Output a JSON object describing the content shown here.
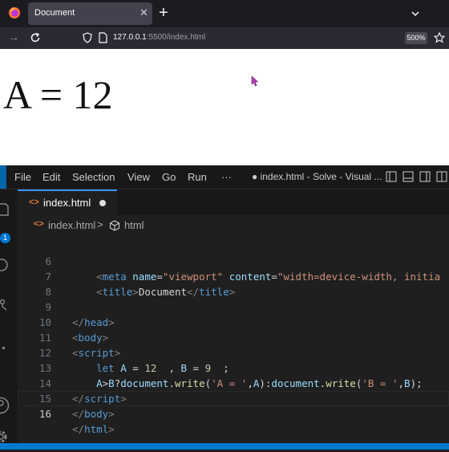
{
  "browser": {
    "tab_title": "Document",
    "tab_close_glyph": "✕",
    "new_tab_glyph": "+",
    "back_glyph": "→",
    "url_host": "127.0.0.1",
    "url_port_path": ":5500/index.html",
    "zoom": "500%"
  },
  "page": {
    "output": "A = 12"
  },
  "vscode": {
    "menu": [
      "File",
      "Edit",
      "Selection",
      "View",
      "Go",
      "Run",
      "···"
    ],
    "window_title": "● index.html - Solve - Visual ...",
    "activity_badge": "1",
    "editor_tab": {
      "icon": "<>",
      "label": "index.html"
    },
    "breadcrumb": {
      "icon": "<>",
      "file": "index.html",
      "separator": ">",
      "symbol": "html"
    },
    "active_line": 16,
    "lines": [
      {
        "n": "6"
      },
      {
        "n": "7"
      },
      {
        "n": "8"
      },
      {
        "n": "9"
      },
      {
        "n": "10"
      },
      {
        "n": "11"
      },
      {
        "n": "12"
      },
      {
        "n": "13"
      },
      {
        "n": "14"
      },
      {
        "n": "15"
      },
      {
        "n": "16"
      }
    ],
    "code": {
      "l6": {
        "indent": "    ",
        "open": "<",
        "tag": "meta",
        "a1": "name",
        "eq1": "=",
        "v1": "\"viewport\"",
        "a2": "content",
        "eq2": "=",
        "v2": "\"width=device-width, initia"
      },
      "l7": {
        "indent": "    ",
        "open": "<",
        "tag": "title",
        "close": ">",
        "text": "Document",
        "open2": "</",
        "tag2": "title",
        "close2": ">"
      },
      "l9": {
        "open": "</",
        "tag": "head",
        "close": ">"
      },
      "l10": {
        "open": "<",
        "tag": "body",
        "close": ">"
      },
      "l11": {
        "open": "<",
        "tag": "script",
        "close": ">"
      },
      "l12": {
        "indent": "    ",
        "kw": "let",
        "v1": "A",
        "op1": " = ",
        "n1": "12",
        "mid": "  , ",
        "v2": "B",
        "op2": " = ",
        "n2": "9",
        "end": "  ;"
      },
      "l13": {
        "indent": "    ",
        "a": "A",
        "gt": ">",
        "b": "B",
        "q": "?",
        "obj1": "document",
        "d1": ".",
        "fn1": "write",
        "p1": "(",
        "s1": "'A = '",
        "c1": ",",
        "a2": "A",
        "p1c": ")",
        "colon": ":",
        "obj2": "document",
        "d2": ".",
        "fn2": "write",
        "p2": "(",
        "s2": "'B = '",
        "c2": ",",
        "b2": "B",
        "p2c": ");"
      },
      "l14": {
        "open": "</",
        "tag": "script",
        "close": ">"
      },
      "l15": {
        "open": "</",
        "tag": "body",
        "close": ">"
      },
      "l16": {
        "open": "</",
        "tag": "html",
        "close": ">"
      }
    }
  }
}
